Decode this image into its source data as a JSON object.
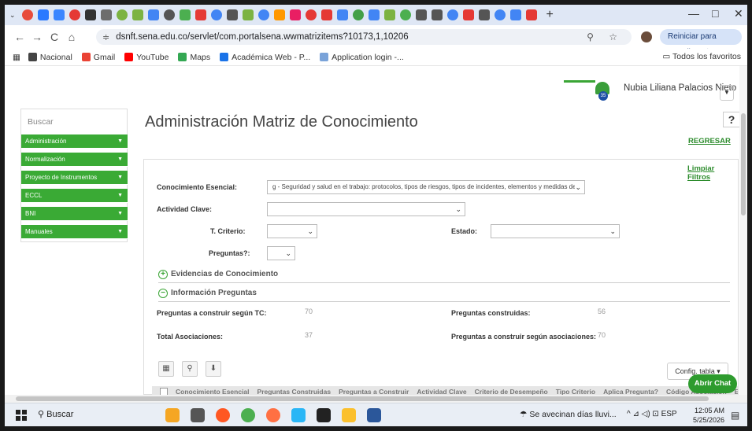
{
  "browser": {
    "tab_icon_colors": [
      "#e74c3c",
      "#2979ff",
      "#3a86ff",
      "#e53935",
      "#333333",
      "#6d6d6d",
      "#7cb342",
      "#7cb342",
      "#4285f4",
      "#555555",
      "#4caf50",
      "#e53935",
      "#4285f4",
      "#555555",
      "#7cb342",
      "#4285f4",
      "#ff9800",
      "#e91e63",
      "#e53935",
      "#e53935",
      "#4285f4",
      "#43a047",
      "#4285f4",
      "#7cb342",
      "#4caf50",
      "#555555",
      "#555555",
      "#4285f4",
      "#e53935",
      "#555555",
      "#4285f4",
      "#4285f4",
      "#e53935"
    ],
    "new_tab": "+",
    "minimize": "—",
    "maximize": "□",
    "close": "✕",
    "back": "←",
    "forward": "→",
    "reload": "C",
    "home": "⌂",
    "url": "dsnft.sena.edu.co/servlet/com.portalsena.wwmatrizitems?10173,1,10206",
    "site_info_icon": "≑",
    "url_actions": "⚲ ☆",
    "restart_button": "Reiniciar para actualizar ⋮",
    "bookmarks": [
      {
        "label": "Nacional",
        "color": "#444444"
      },
      {
        "label": "Gmail",
        "color": "#ea4335"
      },
      {
        "label": "YouTube",
        "color": "#ff0000"
      },
      {
        "label": "Maps",
        "color": "#34a853"
      },
      {
        "label": "Académica Web - P...",
        "color": "#1a73e8"
      },
      {
        "label": "Application login -...",
        "color": "#7aa3d9"
      }
    ],
    "all_bookmarks": "Todos los favoritos"
  },
  "header": {
    "user_name": "Nubia Liliana Palacios Nieto",
    "notification_count": "35",
    "user_menu_icon": "▼"
  },
  "sidebar": {
    "search_label": "Buscar",
    "items": [
      {
        "label": "Administración"
      },
      {
        "label": "Normalización"
      },
      {
        "label": "Proyecto de Instrumentos"
      },
      {
        "label": "ECCL"
      },
      {
        "label": "BNI"
      },
      {
        "label": "Manuales"
      }
    ],
    "caret": "▼"
  },
  "main": {
    "title": "Administración Matriz de Conocimiento",
    "help": "?",
    "regresar": "REGRESAR",
    "limpiar": "Limpiar Filtros",
    "filters": {
      "conocimiento_label": "Conocimiento Esencial:",
      "conocimiento_value": "g - Seguridad y salud en el trabajo: protocolos, tipos de riesgos, tipos de incidentes, elementos y medidas de",
      "actividad_label": "Actividad Clave:",
      "actividad_value": "",
      "criterio_label": "T. Criterio:",
      "criterio_value": "",
      "estado_label": "Estado:",
      "estado_value": "",
      "preguntas_label": "Preguntas?:",
      "preguntas_value": "",
      "chevron": "⌄"
    },
    "sections": {
      "evidencias": "Evidencias de Conocimiento",
      "evidencias_icon": "+",
      "info": "Información Preguntas",
      "info_icon": "−"
    },
    "stats": [
      {
        "label": "Preguntas a construir según TC:",
        "value": "70"
      },
      {
        "label": "Preguntas construidas:",
        "value": "56"
      },
      {
        "label": "Total Asociaciones:",
        "value": "37"
      },
      {
        "label": "Preguntas a construir según asociaciones:",
        "value": "70"
      }
    ],
    "toolbar": {
      "config": "Config. tabla ▾",
      "excel_icon": "▦",
      "search_icon": "⚲",
      "export_icon": "⬇"
    },
    "table_headers": [
      "Conocimiento Esencial",
      "Preguntas Construidas",
      "Preguntas a Construir",
      "Actividad Clave",
      "Criterio de Desempeño",
      "Tipo Criterio",
      "Aplica Pregunta?",
      "Código Asociación",
      "Estado Pr"
    ],
    "chat_button": "Abrir Chat"
  },
  "taskbar": {
    "search": "Buscar",
    "weather": "Se avecinan días lluvi...",
    "tray": "^  ⊿ ◁) ⊡  ESP",
    "time": "12:05 AM",
    "date": "5/25/2026",
    "app_colors": [
      "#f5a623",
      "#555555",
      "#ff5722",
      "#4caf50",
      "#ff7043",
      "#29b6f6",
      "#222222",
      "#fbc02d",
      "#2b579a"
    ]
  }
}
